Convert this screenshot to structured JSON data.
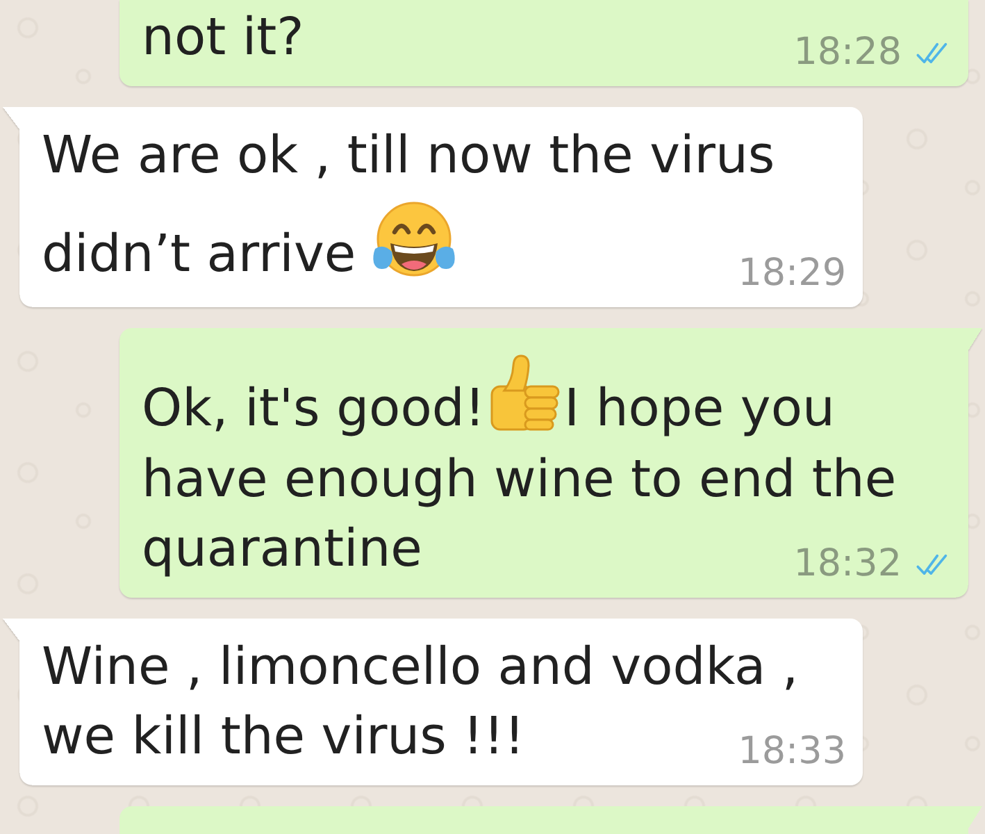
{
  "messages": [
    {
      "kind": "outgoing",
      "lines": [
        {
          "parts": [
            {
              "kind": "text",
              "text": "not it?"
            }
          ]
        }
      ],
      "time": "18:28",
      "read": true
    },
    {
      "kind": "incoming",
      "lines": [
        {
          "parts": [
            {
              "kind": "text",
              "text": "We are ok , till now the virus"
            }
          ]
        },
        {
          "parts": [
            {
              "kind": "text",
              "text": "didn’t arrive"
            },
            {
              "kind": "laughing"
            }
          ]
        }
      ],
      "time": "18:29"
    },
    {
      "kind": "outgoing",
      "lines": [
        {
          "parts": [
            {
              "kind": "text",
              "text": "Ok, it's good!"
            },
            {
              "kind": "thumbsup"
            },
            {
              "kind": "text",
              "text": "I hope you"
            }
          ]
        },
        {
          "parts": [
            {
              "kind": "text",
              "text": "have enough wine to end the"
            }
          ]
        },
        {
          "parts": [
            {
              "kind": "text",
              "text": "quarantine"
            }
          ]
        }
      ],
      "time": "18:32",
      "read": true
    },
    {
      "kind": "incoming",
      "lines": [
        {
          "parts": [
            {
              "kind": "text",
              "text": "Wine , limoncello and vodka ,"
            }
          ]
        },
        {
          "parts": [
            {
              "kind": "text",
              "text": "we kill the virus !!!"
            }
          ]
        }
      ],
      "time": "18:33"
    },
    {
      "kind": "outgoing"
    }
  ]
}
